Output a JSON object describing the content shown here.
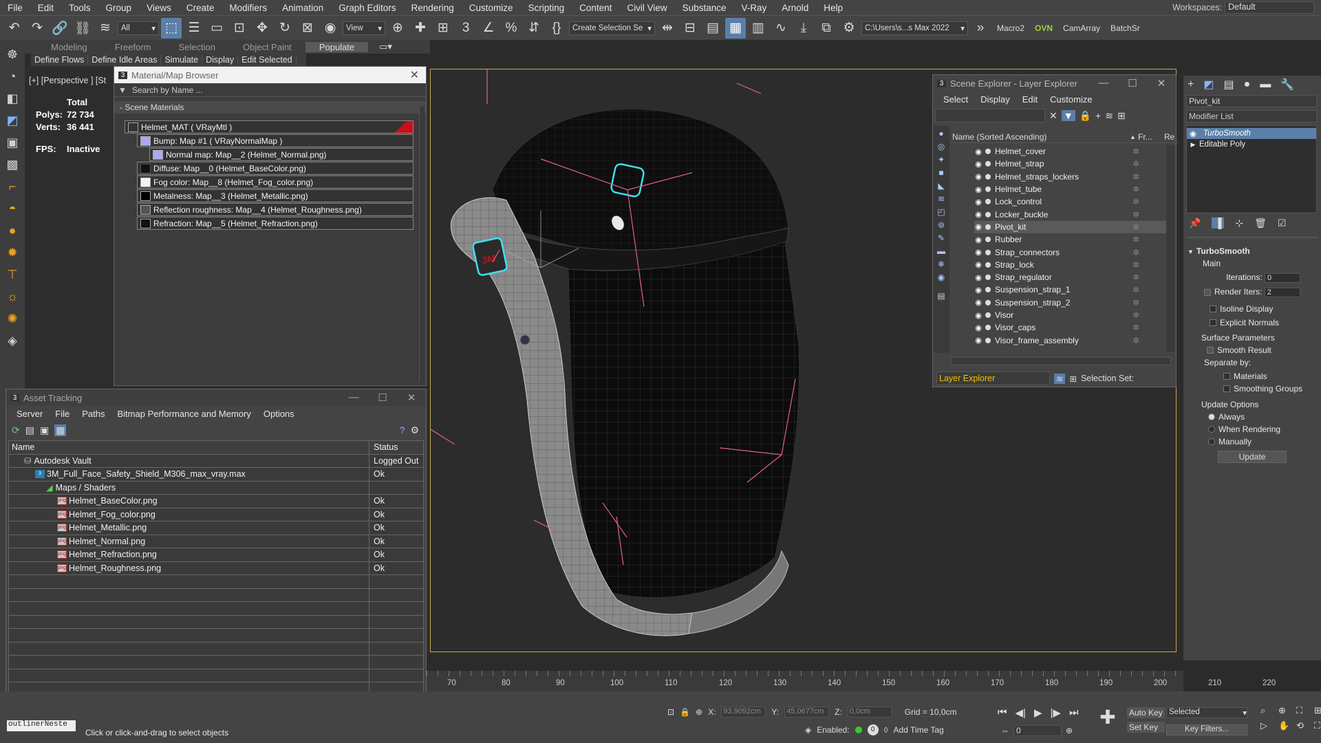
{
  "menubar": {
    "items": [
      "File",
      "Edit",
      "Tools",
      "Group",
      "Views",
      "Create",
      "Modifiers",
      "Animation",
      "Graph Editors",
      "Rendering",
      "Customize",
      "Scripting",
      "Content",
      "Civil View",
      "Substance",
      "V-Ray",
      "Arnold",
      "Help"
    ],
    "workspaces_label": "Workspaces:",
    "workspaces_value": "Default"
  },
  "toolbar": {
    "filter_value": "All",
    "refcoord_value": "View",
    "create_selection_set": "Create Selection Se",
    "project_path": "C:\\Users\\s...s Max 2022",
    "macro2": "Macro2",
    "ovn": "OVN",
    "camarray": "CamArray",
    "batchsr": "BatchSr"
  },
  "ribbon": {
    "tabs": [
      "Modeling",
      "Freeform",
      "Selection",
      "Object Paint",
      "Populate"
    ],
    "active": "Populate",
    "subtabs": [
      "Define Flows",
      "Define Idle Areas",
      "Simulate",
      "Display",
      "Edit Selected"
    ]
  },
  "viewport": {
    "label": "[+] [Perspective ] [St",
    "stats_total": "Total",
    "polys_label": "Polys:",
    "polys_value": "72 734",
    "verts_label": "Verts:",
    "verts_value": "36 441",
    "fps_label": "FPS:",
    "fps_value": "Inactive"
  },
  "material_browser": {
    "title": "Material/Map Browser",
    "search_placeholder": "Search by Name ...",
    "section": "- Scene Materials",
    "rows": [
      "Helmet_MAT  ( VRayMtl )",
      "Bump: Map #1  ( VRayNormalMap )",
      "Normal map: Map__2 (Helmet_Normal.png)",
      "Diffuse: Map__0 (Helmet_BaseColor.png)",
      "Fog color: Map__8 (Helmet_Fog_color.png)",
      "Metalness: Map__3 (Helmet_Metallic.png)",
      "Reflection roughness: Map__4 (Helmet_Roughness.png)",
      "Refraction: Map__5 (Helmet_Refraction.png)"
    ]
  },
  "asset_tracking": {
    "title": "Asset Tracking",
    "menu": [
      "Server",
      "File",
      "Paths",
      "Bitmap Performance and Memory",
      "Options"
    ],
    "col_name": "Name",
    "col_status": "Status",
    "rows": [
      {
        "name": "Autodesk Vault",
        "status": "Logged Out"
      },
      {
        "name": "3M_Full_Face_Safety_Shield_M306_max_vray.max",
        "status": "Ok"
      },
      {
        "name": "Maps / Shaders",
        "status": ""
      },
      {
        "name": "Helmet_BaseColor.png",
        "status": "Ok"
      },
      {
        "name": "Helmet_Fog_color.png",
        "status": "Ok"
      },
      {
        "name": "Helmet_Metallic.png",
        "status": "Ok"
      },
      {
        "name": "Helmet_Normal.png",
        "status": "Ok"
      },
      {
        "name": "Helmet_Refraction.png",
        "status": "Ok"
      },
      {
        "name": "Helmet_Roughness.png",
        "status": "Ok"
      }
    ]
  },
  "scene_explorer": {
    "title": "Scene Explorer - Layer Explorer",
    "menu": [
      "Select",
      "Display",
      "Edit",
      "Customize"
    ],
    "col_name": "Name (Sorted Ascending)",
    "col_fr": "Fr...",
    "col_re": "Re",
    "items": [
      "Helmet_cover",
      "Helmet_strap",
      "Helmet_straps_lockers",
      "Helmet_tube",
      "Lock_control",
      "Locker_buckle",
      "Pivot_kit",
      "Rubber",
      "Strap_connectors",
      "Strap_lock",
      "Strap_regulator",
      "Suspension_strap_1",
      "Suspension_strap_2",
      "Visor",
      "Visor_caps",
      "Visor_frame_assembly"
    ],
    "selected": "Pivot_kit",
    "footer_layer": "Layer Explorer",
    "footer_selset": "Selection Set:"
  },
  "command_panel": {
    "object_name": "Pivot_kit",
    "modifier_list": "Modifier List",
    "stack": [
      "TurboSmooth",
      "Editable Poly"
    ],
    "rollout_title": "TurboSmooth",
    "main_label": "Main",
    "iterations_label": "Iterations:",
    "iterations_value": "0",
    "render_iters_label": "Render Iters:",
    "render_iters_value": "2",
    "isoline": "Isoline Display",
    "explicit_normals": "Explicit Normals",
    "surface_params": "Surface Parameters",
    "smooth_result": "Smooth Result",
    "separate_by": "Separate by:",
    "materials": "Materials",
    "smoothing_groups": "Smoothing Groups",
    "update_options": "Update Options",
    "always": "Always",
    "when_rendering": "When Rendering",
    "manually": "Manually",
    "update_button": "Update"
  },
  "timeline": {
    "ticks": [
      "70",
      "80",
      "90",
      "100",
      "110",
      "120",
      "130",
      "140",
      "150",
      "160",
      "170",
      "180",
      "190",
      "200",
      "210",
      "220"
    ]
  },
  "statusbar": {
    "outliner_label": "outlinerNeste",
    "prompt": "Click or click-and-drag to select objects",
    "x_label": "X:",
    "x_value": "93,9092cm",
    "y_label": "Y:",
    "y_value": "45,0677cm",
    "z_label": "Z:",
    "z_value": "0,0cm",
    "grid": "Grid = 10,0cm",
    "enabled_label": "Enabled:",
    "add_time_tag": "Add Time Tag",
    "auto_key": "Auto Key",
    "set_key": "Set Key",
    "selected_value": "Selected",
    "key_filters": "Key Filters...",
    "frame_value": "0"
  }
}
